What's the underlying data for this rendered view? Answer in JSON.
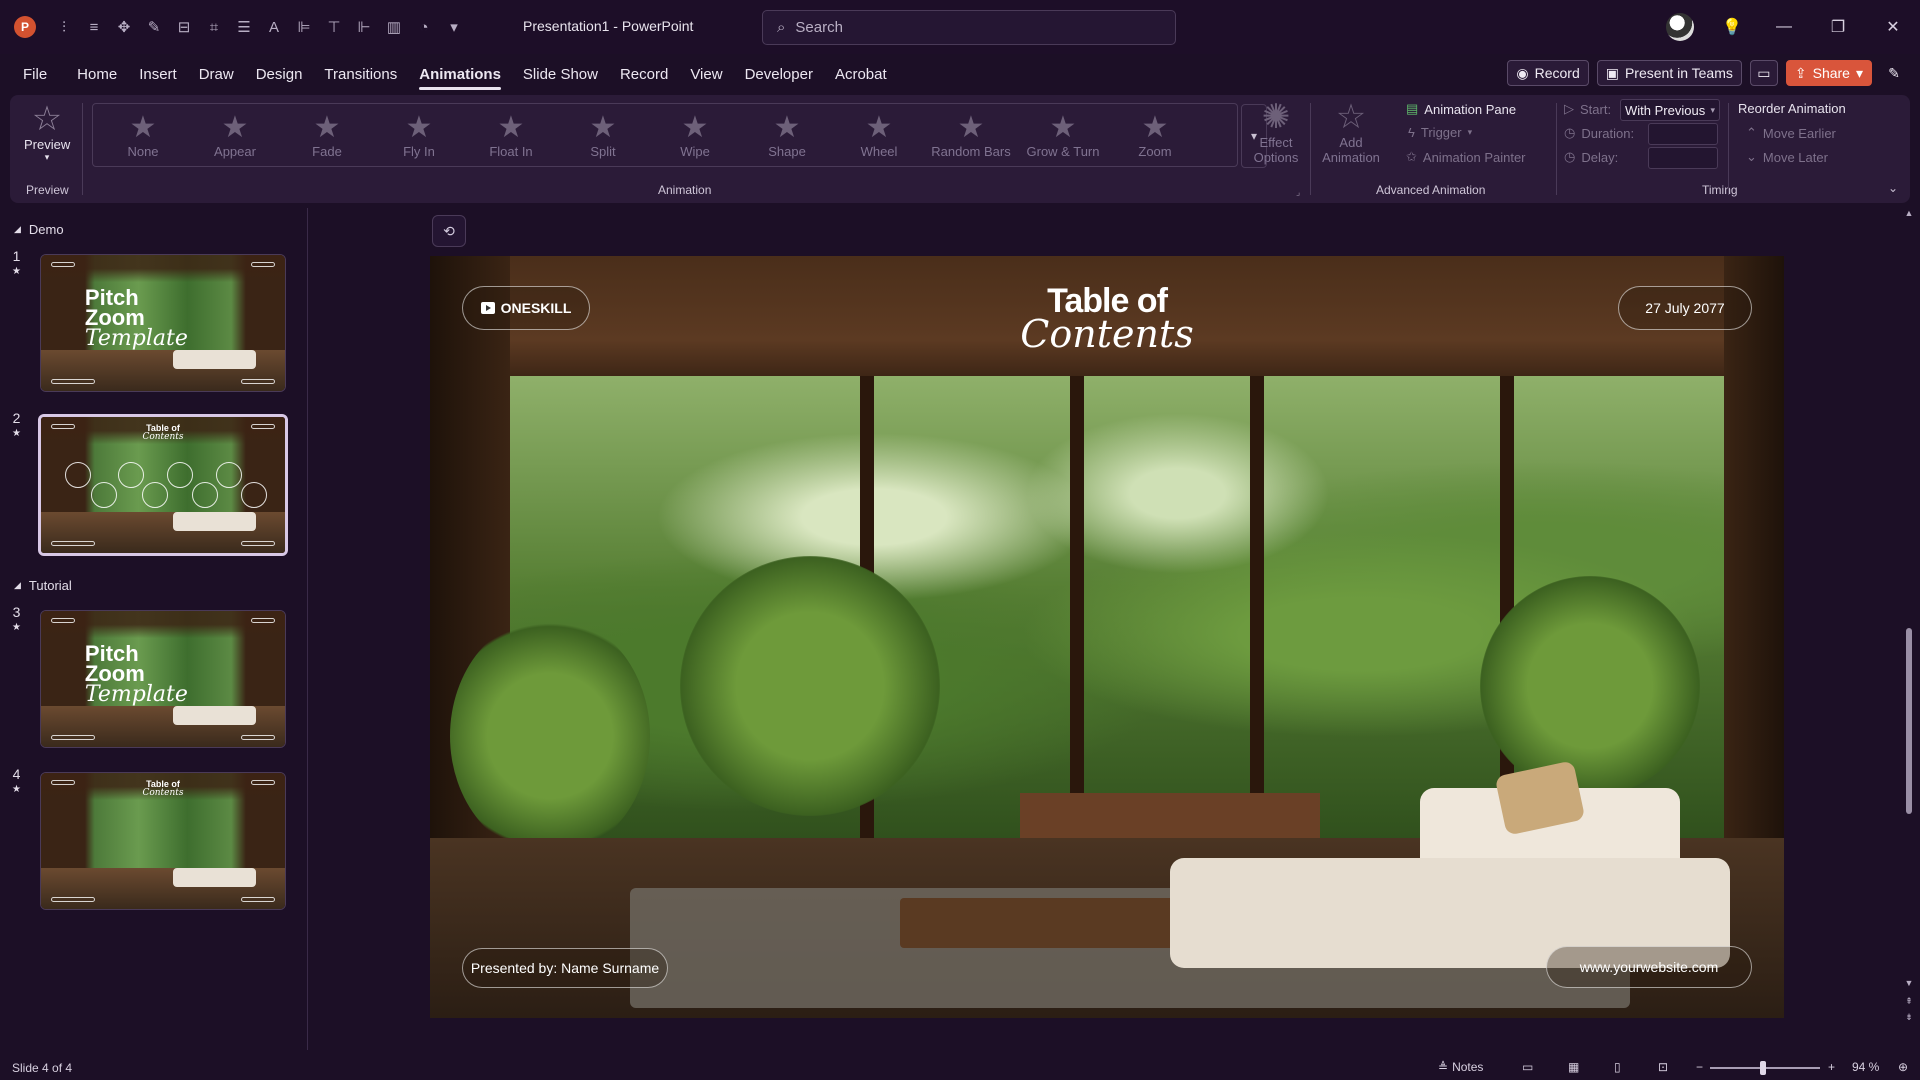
{
  "titlebar": {
    "app_logo": "P",
    "doc_title": "Presentation1  -  PowerPoint",
    "search_placeholder": "Search"
  },
  "tabs": [
    "File",
    "Home",
    "Insert",
    "Draw",
    "Design",
    "Transitions",
    "Animations",
    "Slide Show",
    "Record",
    "View",
    "Developer",
    "Acrobat"
  ],
  "active_tab": "Animations",
  "tab_actions": {
    "record": "Record",
    "present_teams": "Present in Teams",
    "share": "Share"
  },
  "ribbon": {
    "preview": {
      "label": "Preview",
      "group": "Preview"
    },
    "animation_group": "Animation",
    "animations": [
      "None",
      "Appear",
      "Fade",
      "Fly In",
      "Float In",
      "Split",
      "Wipe",
      "Shape",
      "Wheel",
      "Random Bars",
      "Grow & Turn",
      "Zoom"
    ],
    "effect_options": [
      "Effect",
      "Options"
    ],
    "add_animation": [
      "Add",
      "Animation"
    ],
    "animation_pane": "Animation Pane",
    "trigger": "Trigger",
    "animation_painter": "Animation Painter",
    "advanced_group": "Advanced Animation",
    "start_label": "Start:",
    "start_value": "With Previous",
    "duration_label": "Duration:",
    "delay_label": "Delay:",
    "timing_group": "Timing",
    "reorder_title": "Reorder Animation",
    "move_earlier": "Move Earlier",
    "move_later": "Move Later"
  },
  "sections": [
    {
      "name": "Demo"
    },
    {
      "name": "Tutorial"
    }
  ],
  "slides": [
    {
      "num": "1",
      "title": [
        "Pitch",
        "Zoom",
        "Template"
      ]
    },
    {
      "num": "2",
      "title": [
        "Table of",
        "Contents"
      ]
    },
    {
      "num": "3",
      "title": [
        "Pitch",
        "Zoom",
        "Template"
      ]
    },
    {
      "num": "4",
      "title": [
        "Table of",
        "Contents"
      ]
    }
  ],
  "slide": {
    "brand": "ONESKILL",
    "title_line1": "Table of",
    "title_line2": "Contents",
    "date": "27 July 2077",
    "presented_by": "Presented by: Name Surname",
    "website": "www.yourwebsite.com"
  },
  "statusbar": {
    "slide_info": "Slide 4 of 4",
    "notes": "Notes",
    "zoom": "94 %"
  },
  "colors": {
    "background": "#1c0f26",
    "ribbon": "#2b1b38",
    "share": "#d9553b",
    "app_logo": "#d35230"
  }
}
